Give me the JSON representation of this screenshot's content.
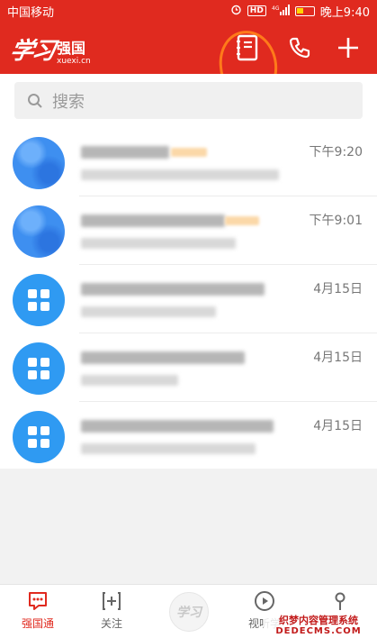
{
  "status_bar": {
    "carrier": "中国移动",
    "hd": "HD",
    "signal": "4G",
    "time": "晚上9:40"
  },
  "app_bar": {
    "logo_script": "学习",
    "logo_main": "强国",
    "logo_sub": "xuexi.cn",
    "icons": [
      "contacts-book-icon",
      "phone-icon",
      "plus-icon"
    ]
  },
  "search": {
    "placeholder": "搜索"
  },
  "chats": [
    {
      "time": "下午9:20",
      "avatar": "pixelated"
    },
    {
      "time": "下午9:01",
      "avatar": "pixelated"
    },
    {
      "time": "4月15日",
      "avatar": "grid-icon"
    },
    {
      "time": "4月15日",
      "avatar": "grid-icon"
    },
    {
      "time": "4月15日",
      "avatar": "grid-icon"
    }
  ],
  "bottom_nav": {
    "items": [
      {
        "label": "强国通",
        "icon": "chat-bubble-icon",
        "active": true
      },
      {
        "label": "关注",
        "icon": "plus-box-icon",
        "active": false
      },
      {
        "label": "",
        "icon": "xuexi-logo-icon",
        "active": false
      },
      {
        "label": "视听学",
        "icon": "play-icon",
        "active": false
      },
      {
        "label": "",
        "icon": "profile-icon",
        "active": false
      }
    ],
    "center_text": "学习"
  },
  "watermark": {
    "line1": "织梦内容管理系统",
    "line2": "DEDECMS.COM"
  },
  "colors": {
    "brand_red": "#e02a1f",
    "annotation_orange": "#ff7a1a",
    "avatar_blue": "#2f9af2"
  }
}
